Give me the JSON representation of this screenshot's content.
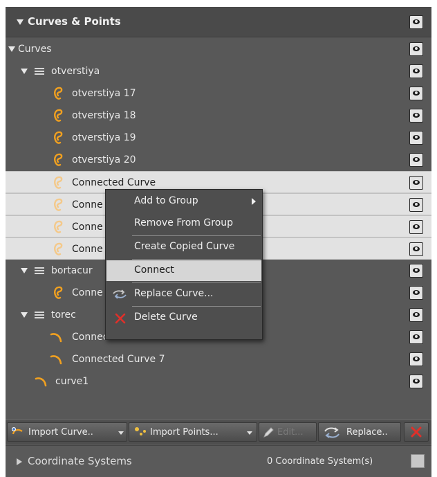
{
  "panel": {
    "title": "Curves & Points"
  },
  "tree": {
    "root_label": "Curves",
    "group1": {
      "label": "otverstiya"
    },
    "g1_items": [
      "otverstiya 17",
      "otverstiya 18",
      "otverstiya 19",
      "otverstiya 20",
      "Connected Curve",
      "Conne",
      "Conne",
      "Conne"
    ],
    "group2": {
      "label": "bortacur"
    },
    "g2_items": [
      "Conne"
    ],
    "group3": {
      "label": "torec"
    },
    "g3_items": [
      "Connected Curve 6",
      "Connected Curve 7"
    ],
    "loose_items": [
      "curve1"
    ]
  },
  "context_menu": {
    "items": [
      {
        "label": "Add to Group"
      },
      {
        "label": "Remove From Group"
      },
      {
        "label": "Create Copied Curve"
      },
      {
        "label": "Connect"
      },
      {
        "label": "Replace Curve..."
      },
      {
        "label": "Delete Curve"
      }
    ]
  },
  "toolbar": {
    "import_curve": "Import Curve..",
    "import_points": "Import Points...",
    "edit": "Edit...",
    "replace": "Replace.."
  },
  "footer": {
    "section_label": "Coordinate Systems",
    "count_text": "0 Coordinate System(s)"
  },
  "colors": {
    "panel_bg": "#585858",
    "selected_row_bg": "#e2e2e2",
    "curve_icon": "#f0a020",
    "delete_red": "#e0302a"
  }
}
